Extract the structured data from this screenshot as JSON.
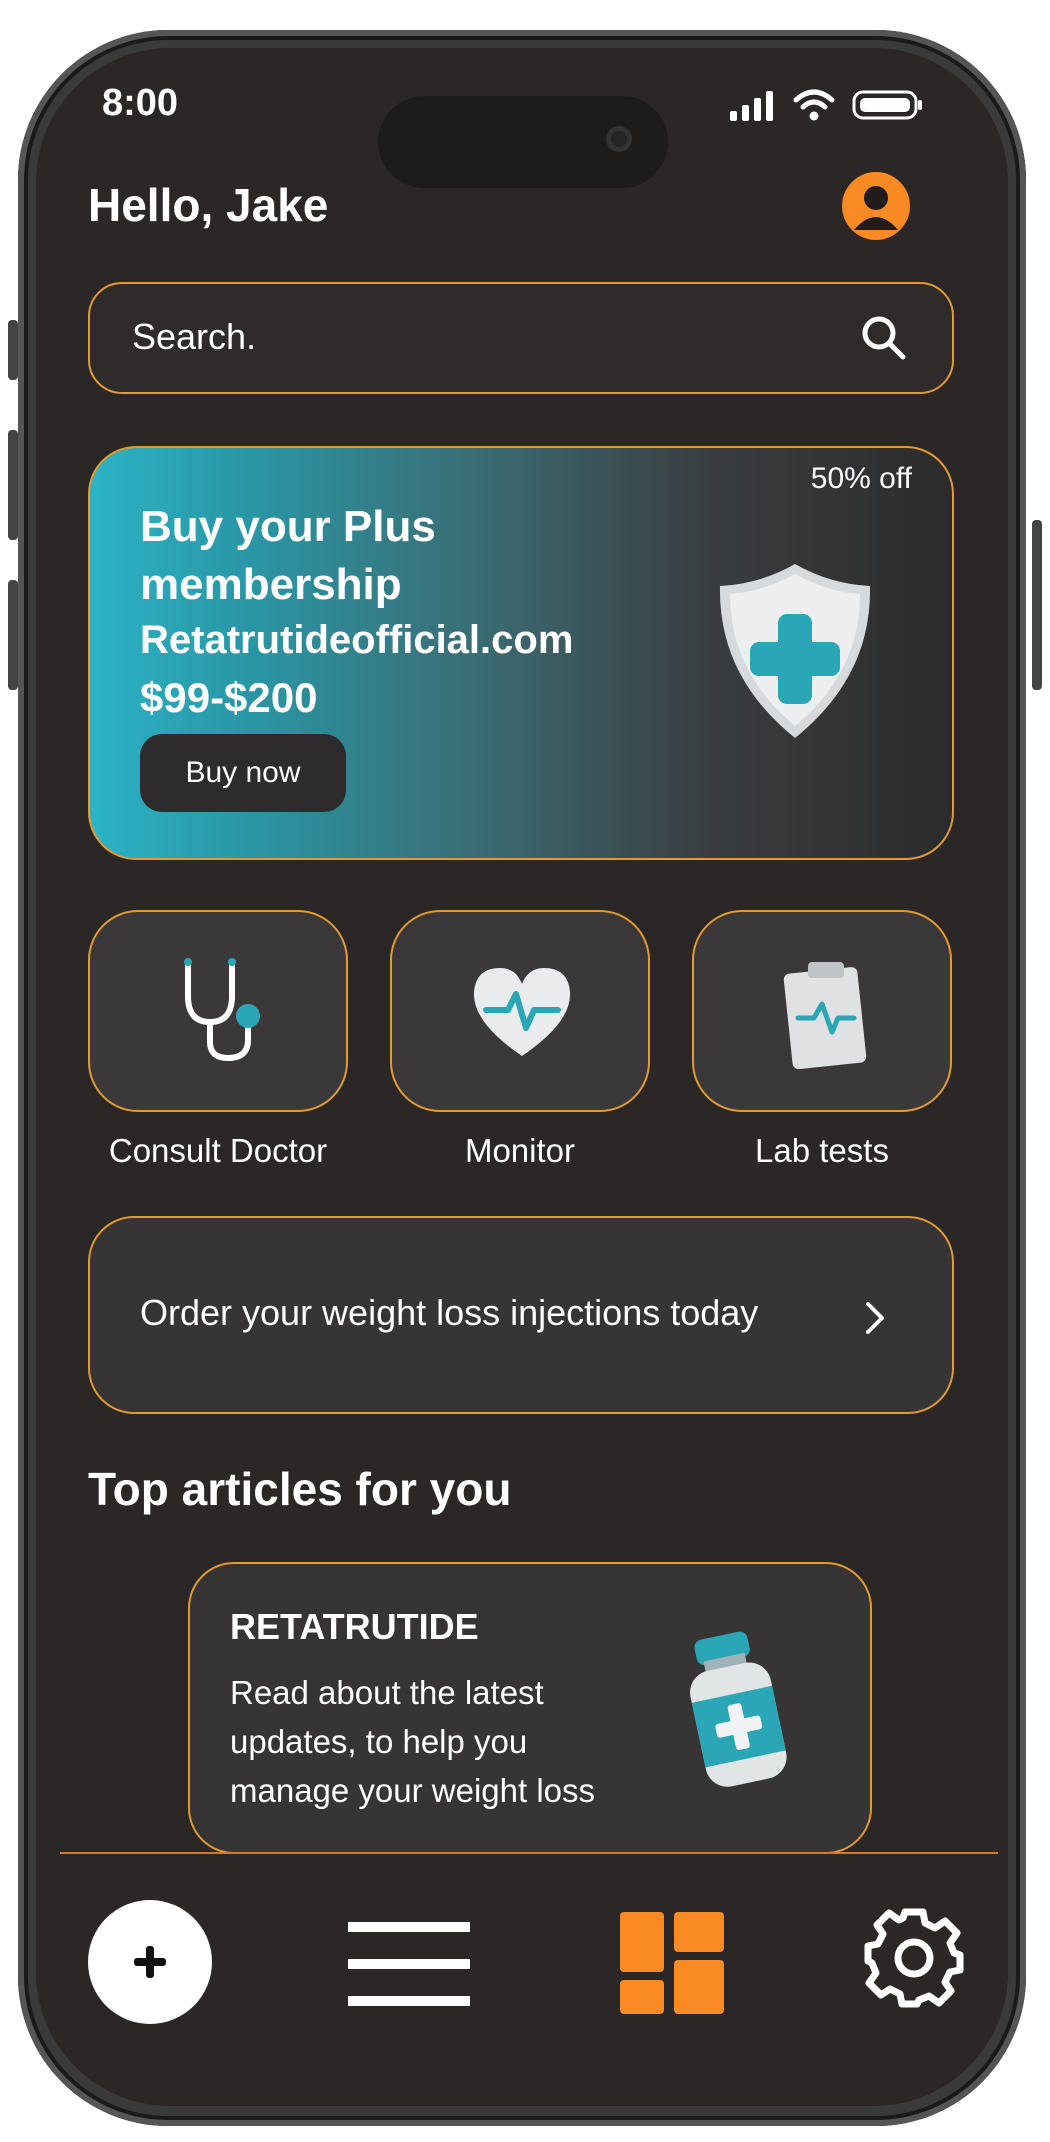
{
  "status_bar": {
    "time": "8:00"
  },
  "header": {
    "greeting": "Hello, Jake"
  },
  "search": {
    "placeholder": "Search."
  },
  "promo": {
    "badge": "50% off",
    "title": "Buy your Plus membership",
    "website": "Retatrutideofficial.com",
    "price": "$99-$200",
    "button_label": "Buy now"
  },
  "quick_actions": [
    {
      "label": "Consult Doctor",
      "icon": "stethoscope-icon"
    },
    {
      "label": "Monitor",
      "icon": "heart-monitor-icon"
    },
    {
      "label": "Lab tests",
      "icon": "clipboard-icon"
    }
  ],
  "order_banner": {
    "text": "Order your weight loss injections today"
  },
  "articles": {
    "section_title": "Top articles for you",
    "items": [
      {
        "title": "RETATRUTIDE",
        "body": "Read about the latest updates, to help you manage your weight loss"
      }
    ]
  },
  "bottom_nav": [
    {
      "name": "add",
      "icon": "plus-icon"
    },
    {
      "name": "menu",
      "icon": "hamburger-icon"
    },
    {
      "name": "dashboard",
      "icon": "grid-icon",
      "active": true
    },
    {
      "name": "settings",
      "icon": "gear-icon"
    }
  ],
  "colors": {
    "accent": "#f98a24",
    "border": "#e39a2e",
    "background": "#2a2726",
    "teal": "#2bb3c6"
  }
}
